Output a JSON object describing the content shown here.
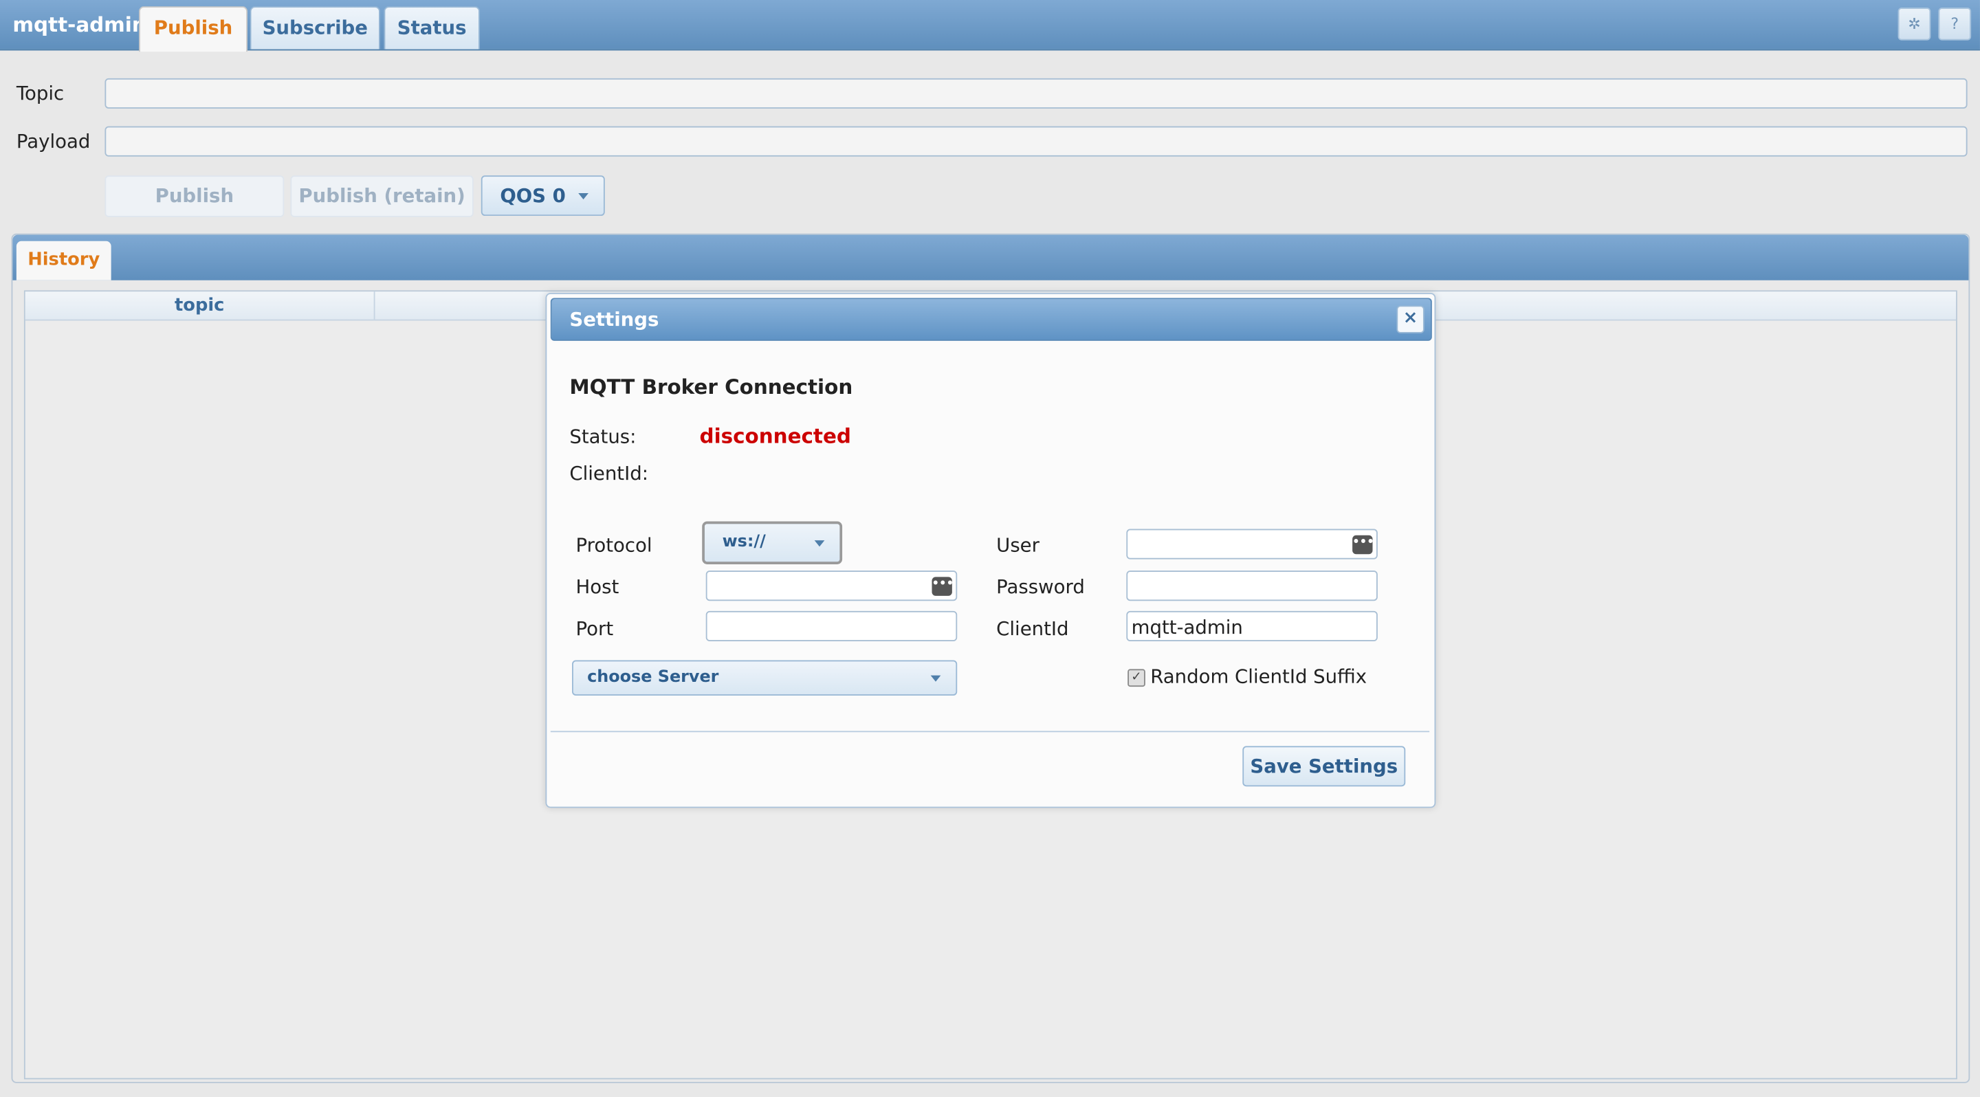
{
  "app": {
    "title": "mqtt-admin"
  },
  "tabs": [
    {
      "label": "Publish",
      "active": true
    },
    {
      "label": "Subscribe",
      "active": false
    },
    {
      "label": "Status",
      "active": false
    }
  ],
  "header_icons": {
    "settings": "gear-icon",
    "help": "?"
  },
  "publish": {
    "topic_label": "Topic",
    "topic_value": "",
    "payload_label": "Payload",
    "payload_value": "",
    "publish_button": "Publish",
    "publish_retain_button": "Publish (retain)",
    "qos_selected": "QOS 0"
  },
  "history": {
    "tab_label": "History",
    "columns": [
      "topic"
    ]
  },
  "settings_dialog": {
    "title": "Settings",
    "close": "×",
    "section_title": "MQTT Broker Connection",
    "status_label": "Status:",
    "status_value": "disconnected",
    "clientid_label": "ClientId:",
    "clientid_value": "",
    "protocol_label": "Protocol",
    "protocol_value": "ws://",
    "host_label": "Host",
    "host_value": "",
    "port_label": "Port",
    "port_value": "",
    "choose_server": "choose Server",
    "user_label": "User",
    "user_value": "",
    "password_label": "Password",
    "password_value": "",
    "clientid_field_label": "ClientId",
    "clientid_field_value": "mqtt-admin",
    "random_suffix_label": "Random ClientId Suffix",
    "random_suffix_checked": true,
    "save_button": "Save Settings"
  },
  "colors": {
    "accent_orange": "#e07b1a",
    "header_blue": "#5f8fbd",
    "status_red": "#cc0000"
  }
}
